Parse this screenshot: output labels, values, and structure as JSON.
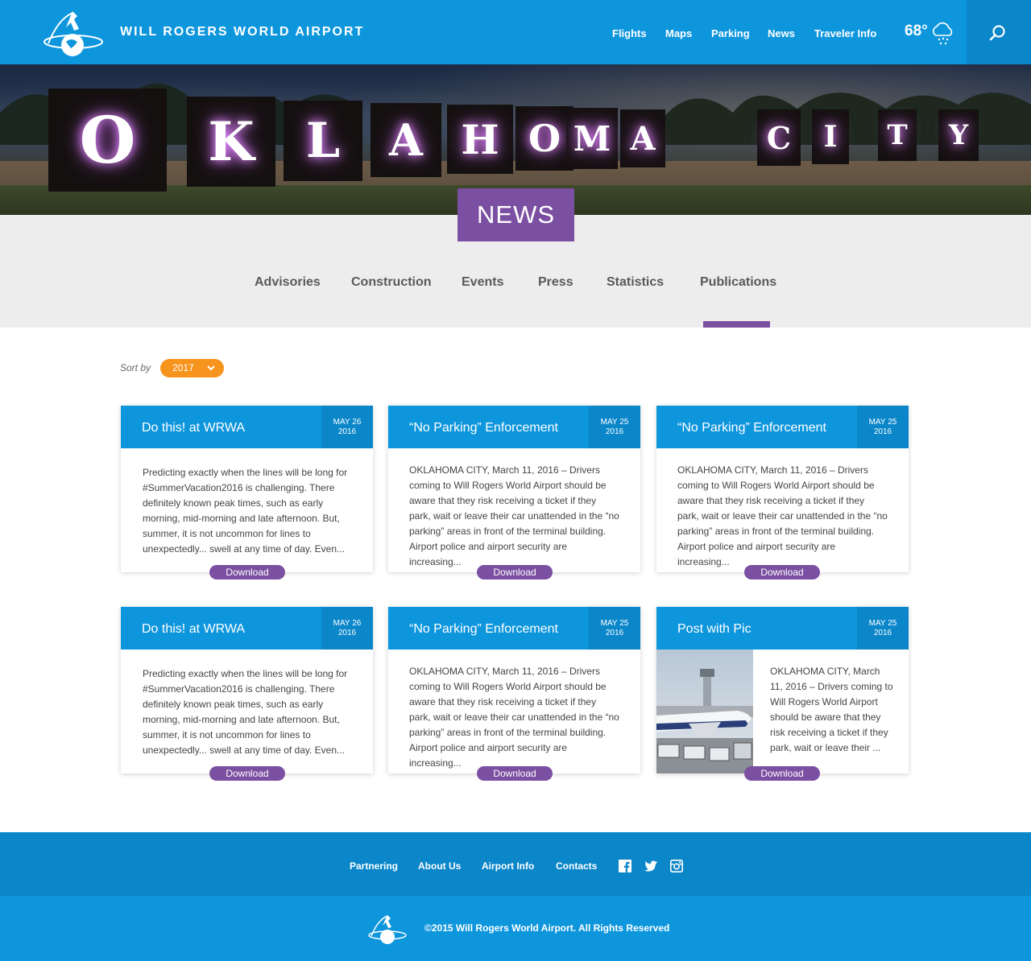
{
  "header": {
    "brand": "WILL ROGERS WORLD AIRPORT",
    "nav": [
      "Flights",
      "Maps",
      "Parking",
      "News",
      "Traveler Info"
    ],
    "temperature": "68°",
    "weather_icon": "cloud-snow-icon",
    "search_icon": "search-icon"
  },
  "hero": {
    "letters": [
      "O",
      "K",
      "L",
      "A",
      "H",
      "O",
      "M",
      "A",
      "C",
      "I",
      "T",
      "Y"
    ],
    "badge": "NEWS"
  },
  "tabs": {
    "items": [
      "Advisories",
      "Construction",
      "Events",
      "Press",
      "Statistics",
      "Publications"
    ],
    "active": "Publications"
  },
  "sort": {
    "label": "Sort by",
    "value": "2017"
  },
  "cards": [
    {
      "title": "Do this! at WRWA",
      "date_month": "MAY 26",
      "date_year": "2016",
      "body": "Predicting exactly when the lines will be long for #SummerVacation2016 is challenging.  There definitely known peak times, such as early morning, mid-morning and late afternoon. But, summer, it is not uncommon for lines to unexpectedly... swell at any time of day.  Even...",
      "button": "Download"
    },
    {
      "title": "“No Parking” Enforcement",
      "date_month": "MAY 25",
      "date_year": "2016",
      "body": "OKLAHOMA CITY, March 11, 2016 – Drivers coming to Will Rogers World Airport should be aware that they risk receiving a ticket if they park, wait or leave their car unattended in the “no parking” areas in front of the terminal building. Airport police and airport security are increasing...",
      "button": "Download"
    },
    {
      "title": "“No Parking” Enforcement",
      "date_month": "MAY 25",
      "date_year": "2016",
      "body": "OKLAHOMA CITY, March 11, 2016 – Drivers coming to Will Rogers World Airport should be aware that they risk receiving a ticket if they park, wait or leave their car unattended in the “no parking” areas in front of the terminal building. Airport police and airport security are increasing...",
      "button": "Download"
    },
    {
      "title": "Do this! at WRWA",
      "date_month": "MAY 26",
      "date_year": "2016",
      "body": "Predicting exactly when the lines will be long for #SummerVacation2016 is challenging.  There definitely known peak times, such as early morning, mid-morning and late afternoon. But, summer, it is not uncommon for lines to unexpectedly... swell at any time of day.  Even...",
      "button": "Download"
    },
    {
      "title": "“No Parking” Enforcement",
      "date_month": "MAY 25",
      "date_year": "2016",
      "body": "OKLAHOMA CITY, March 11, 2016 – Drivers coming to Will Rogers World Airport should be aware that they risk receiving a ticket if they park, wait or leave their car unattended in the “no parking” areas in front of the terminal building. Airport police and airport security are increasing...",
      "button": "Download"
    },
    {
      "title": "Post with Pic",
      "date_month": "MAY 25",
      "date_year": "2016",
      "body": "OKLAHOMA CITY, March 11, 2016 – Drivers coming to Will Rogers World Airport should be aware that they risk receiving a ticket if they park, wait or leave their ...",
      "button": "Download"
    }
  ],
  "footer": {
    "links": [
      "Partnering",
      "About Us",
      "Airport Info",
      "Contacts"
    ],
    "social": [
      "facebook-icon",
      "twitter-icon",
      "instagram-icon"
    ],
    "copyright": "©2015 Will Rogers World Airport. All Rights Reserved"
  },
  "colors": {
    "primary_blue": "#0e96dd",
    "dark_blue": "#0a86c9",
    "purple": "#7b4fa1",
    "orange": "#f7941d"
  }
}
